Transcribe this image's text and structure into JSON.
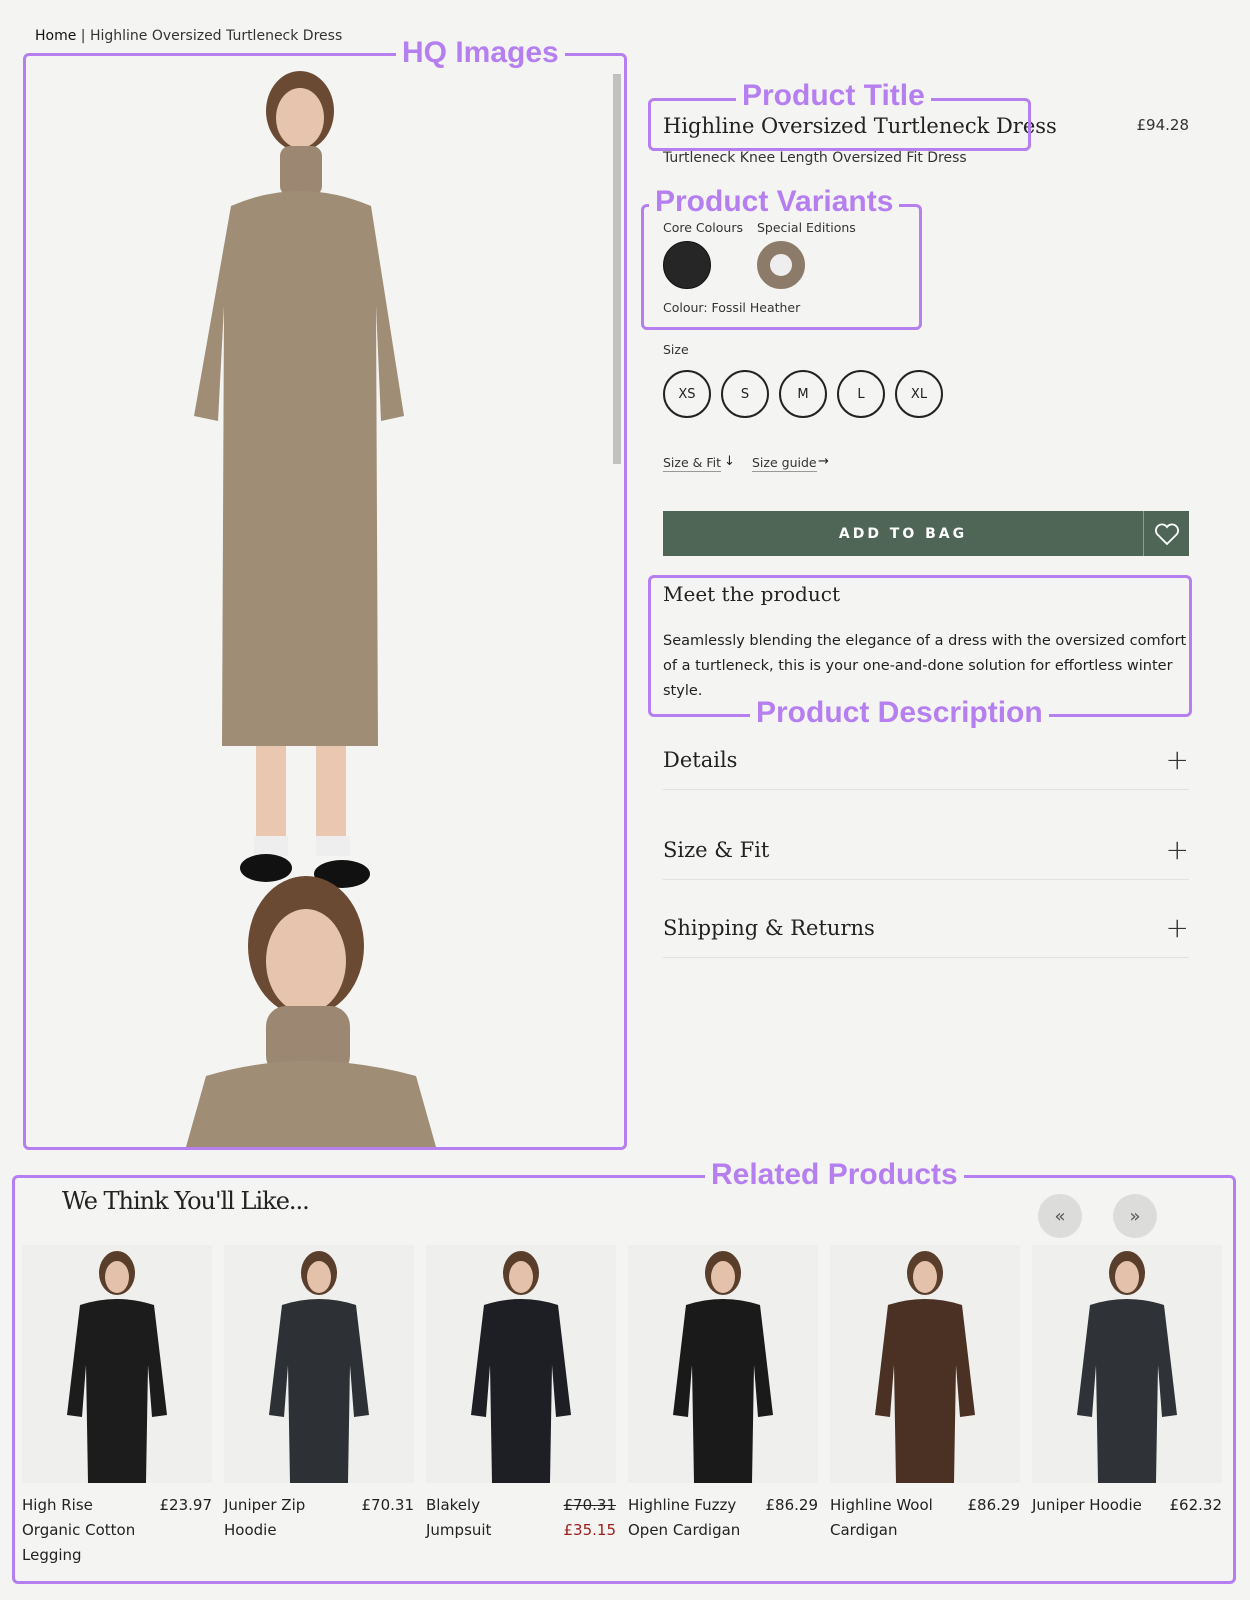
{
  "breadcrumb": {
    "home": "Home",
    "separator": "|",
    "current": "Highline Oversized Turtleneck Dress"
  },
  "annotations": {
    "images": "HQ Images",
    "title": "Product Title",
    "variants": "Product Variants",
    "description": "Product Description",
    "related": "Related Products"
  },
  "product": {
    "title": "Highline Oversized Turtleneck Dress",
    "price": "£94.28",
    "subtitle": "Turtleneck Knee Length Oversized Fit Dress",
    "variants": {
      "core_label": "Core Colours",
      "special_label": "Special Editions",
      "colour_text": "Colour: Fossil Heather",
      "swatches": [
        {
          "name": "black",
          "color": "#262626"
        },
        {
          "name": "fossil-heather",
          "color": "#8d7b6a",
          "selected": true
        }
      ]
    },
    "size_label": "Size",
    "sizes": [
      "XS",
      "S",
      "M",
      "L",
      "XL"
    ],
    "links": [
      {
        "label": "Size & Fit",
        "icon": "arrow-down-icon",
        "glyph": "↓"
      },
      {
        "label": "Size guide",
        "icon": "arrow-right-icon",
        "glyph": "→"
      }
    ],
    "add_to_bag": "ADD TO BAG",
    "meet_title": "Meet the product",
    "description": "Seamlessly blending the elegance of a dress with the oversized comfort of a turtleneck, this is your one-and-done solution for effortless winter style.",
    "accordions": [
      {
        "label": "Details",
        "icon": "+"
      },
      {
        "label": "Size & Fit",
        "icon": "+"
      },
      {
        "label": "Shipping & Returns",
        "icon": "+"
      }
    ]
  },
  "colors": {
    "accent": "#4f6657",
    "annotation": "#b57ff0",
    "sale": "#9b1c1c",
    "dress": "#a08d76"
  },
  "related": {
    "title": "We Think You'll Like...",
    "prev": "«",
    "next": "»",
    "items": [
      {
        "name": "High Rise Organic Cotton Legging",
        "price": "£23.97",
        "color": "#1c1c1c"
      },
      {
        "name": "Juniper Zip Hoodie",
        "price": "£70.31",
        "color": "#2d3035"
      },
      {
        "name": "Blakely Jumpsuit",
        "price": "£70.31",
        "sale_price": "£35.15",
        "color": "#1e1f24"
      },
      {
        "name": "Highline Fuzzy Open Cardigan",
        "price": "£86.29",
        "color": "#1a1a1a"
      },
      {
        "name": "Highline Wool Cardigan",
        "price": "£86.29",
        "color": "#4a3124"
      },
      {
        "name": "Juniper Hoodie",
        "price": "£62.32",
        "color": "#2f3237"
      }
    ]
  }
}
